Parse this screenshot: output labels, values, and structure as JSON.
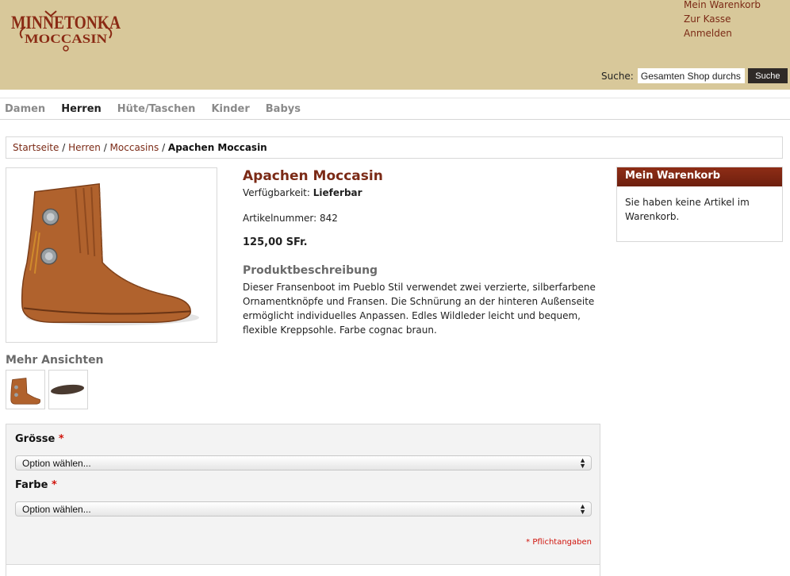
{
  "header": {
    "logo_line1": "MINNETONKA",
    "logo_line2": "MOCCASIN",
    "links": [
      "Mein Warenkorb",
      "Zur Kasse",
      "Anmelden"
    ],
    "search_label": "Suche:",
    "search_value": "Gesamten Shop durchs",
    "search_button": "Suche"
  },
  "nav": {
    "items": [
      "Damen",
      "Herren",
      "Hüte/Taschen",
      "Kinder",
      "Babys"
    ],
    "active": "Herren"
  },
  "breadcrumb": {
    "links": [
      "Startseite",
      "Herren",
      "Moccasins"
    ],
    "current": "Apachen Moccasin"
  },
  "product": {
    "name": "Apachen Moccasin",
    "availability_label": "Verfügbarkeit:",
    "availability_value": "Lieferbar",
    "sku": "Artikelnummer: 842",
    "price": "125,00 SFr.",
    "description_title": "Produktbeschreibung",
    "description": "Dieser Fransenboot im Pueblo Stil verwendet zwei verzierte, silberfarbene Ornamentknöpfe und Fransen. Die Schnürung an der hinteren Außenseite ermöglicht individuelles Anpassen. Edles Wildleder leicht und bequem, flexible Kreppsohle. Farbe cognac braun.",
    "more_views_title": "Mehr Ansichten"
  },
  "cart": {
    "title": "Mein Warenkorb",
    "empty_text": "Sie haben keine Artikel im Warenkorb."
  },
  "options": {
    "size_label": "Grösse",
    "color_label": "Farbe",
    "required_mark": "*",
    "select_placeholder": "Option wählen...",
    "required_note": "* Pflichtangaben"
  },
  "colors": {
    "header_bg": "#d8c89a",
    "brand_red": "#7b2a16",
    "required_red": "#d0140c"
  }
}
